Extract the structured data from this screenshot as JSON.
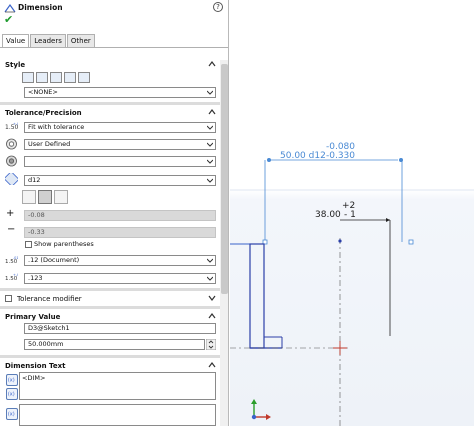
{
  "header": {
    "title": "Dimension",
    "help": "?"
  },
  "tabs": [
    {
      "label": "Value"
    },
    {
      "label": "Leaders"
    },
    {
      "label": "Other"
    }
  ],
  "style": {
    "heading": "Style",
    "combo_value": "<NONE>"
  },
  "tolerance": {
    "heading": "Tolerance/Precision",
    "type": "Fit with tolerance",
    "hole_fit": "User Defined",
    "shaft_fit": "",
    "fit_class": "d12",
    "plus_value": "-0.08",
    "minus_value": "-0.33",
    "show_parentheses_label": "Show parentheses",
    "show_parentheses_checked": false,
    "primary_precision": ".12 (Document)",
    "tolerance_precision": ".123"
  },
  "tolerance_modifier": {
    "label": "Tolerance modifier",
    "checked": false
  },
  "primary_value": {
    "heading": "Primary Value",
    "name": "D3@Sketch1",
    "value": "50.000mm"
  },
  "dimension_text": {
    "heading": "Dimension Text",
    "text": "<DIM>"
  },
  "drawing": {
    "dim_upper": {
      "value": "50.00 d12",
      "tol": "-0.330",
      "tol_top": "-0.080"
    },
    "dim_lower": {
      "value": "38.00",
      "tol_top": "+2",
      "tol_bottom": "- 1"
    }
  },
  "colors": {
    "dim_blue": "#4a8ad4",
    "dim_black": "#222222",
    "accent_blue": "#3a63c9",
    "ok_green": "#1e9a2e"
  }
}
